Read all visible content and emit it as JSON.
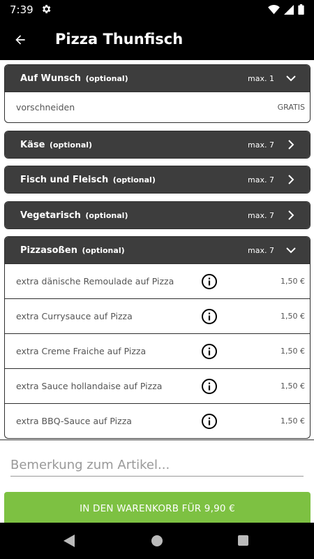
{
  "status_bar": {
    "time": "7:39"
  },
  "app_bar": {
    "title": "Pizza Thunfisch"
  },
  "groups": [
    {
      "title": "Auf Wunsch",
      "optional": "(optional)",
      "max": "max. 1",
      "expanded": true,
      "rows": [
        {
          "label": "vorschneiden",
          "price": "GRATIS"
        }
      ]
    },
    {
      "title": "Käse",
      "optional": "(optional)",
      "max": "max. 7",
      "expanded": false
    },
    {
      "title": "Fisch und Fleisch",
      "optional": "(optional)",
      "max": "max. 7",
      "expanded": false
    },
    {
      "title": "Vegetarisch",
      "optional": "(optional)",
      "max": "max. 7",
      "expanded": false
    },
    {
      "title": "Pizzasoßen",
      "optional": "(optional)",
      "max": "max. 7",
      "expanded": true,
      "rows": [
        {
          "label": "extra dänische Remoulade auf Pizza",
          "price": "1,50 €"
        },
        {
          "label": "extra Currysauce auf Pizza",
          "price": "1,50 €"
        },
        {
          "label": "extra Creme Fraiche auf Pizza",
          "price": "1,50 €"
        },
        {
          "label": "extra Sauce hollandaise auf Pizza",
          "price": "1,50 €"
        },
        {
          "label": "extra BBQ-Sauce auf Pizza",
          "price": "1,50 €"
        }
      ]
    }
  ],
  "remark": {
    "placeholder": "Bemerkung zum Artikel..."
  },
  "cart_button": {
    "label": "IN DEN WARENKORB FÜR 9,90 €"
  },
  "colors": {
    "header_bg": "#3d3d3d",
    "accent_green": "#7dc142",
    "app_bar_bg": "#000000"
  }
}
